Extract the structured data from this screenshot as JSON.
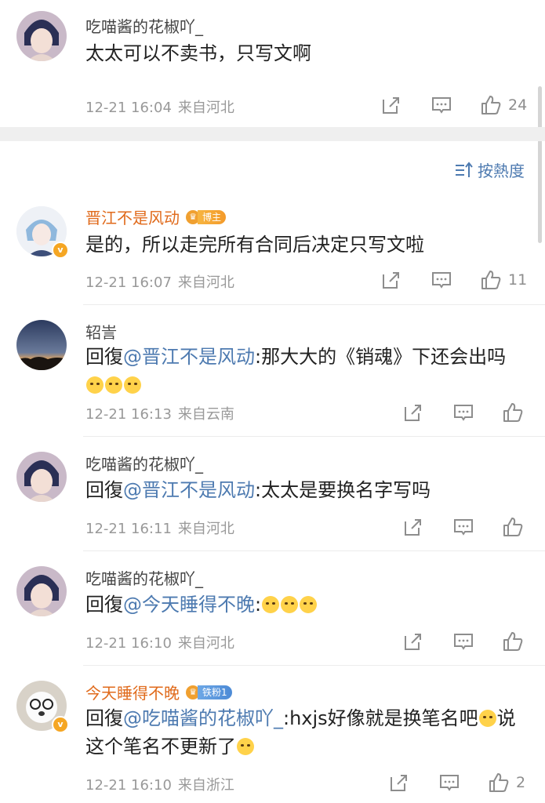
{
  "top_comment": {
    "username": "吃喵酱的花椒吖_",
    "text": "太太可以不卖书，只写文啊",
    "date": "12-21 16:04",
    "location": "来自河北",
    "likes": "24"
  },
  "sort": {
    "label": "按熱度"
  },
  "replies": [
    {
      "username": "晋江不是风动",
      "badge_label": "博主",
      "text": "是的，所以走完所有合同后决定只写文啦",
      "date": "12-21 16:07",
      "location": "来自河北",
      "likes": "11"
    },
    {
      "username": "轺訔",
      "reply_prefix": "回復",
      "mention": "@晋江不是风动",
      "text": ":那大大的《销魂》下还会出吗",
      "date": "12-21 16:13",
      "location": "来自云南"
    },
    {
      "username": "吃喵酱的花椒吖_",
      "reply_prefix": "回復",
      "mention": "@晋江不是风动",
      "text": ":太太是要换名字写吗",
      "date": "12-21 16:11",
      "location": "来自河北"
    },
    {
      "username": "吃喵酱的花椒吖_",
      "reply_prefix": "回復",
      "mention": "@今天睡得不晚",
      "text": ":",
      "date": "12-21 16:10",
      "location": "来自河北"
    },
    {
      "username": "今天睡得不晚",
      "badge_label": "铁粉1",
      "reply_prefix": "回復",
      "mention": "@吃喵酱的花椒吖_",
      "text": ":hxjs好像就是换笔名吧",
      "text_after_emoji": "说",
      "text_line2": "这个笔名不更新了",
      "date": "12-21 16:10",
      "location": "来自浙江",
      "likes": "2"
    }
  ],
  "icons": {
    "share": "share-icon",
    "comment": "comment-icon",
    "like": "like-icon",
    "sort": "sort-icon",
    "emoji": "crying-emoji"
  },
  "colors": {
    "mention": "#4d7ab0",
    "username_highlight": "#e06a1b",
    "meta": "#999999",
    "divider": "#efefef"
  }
}
